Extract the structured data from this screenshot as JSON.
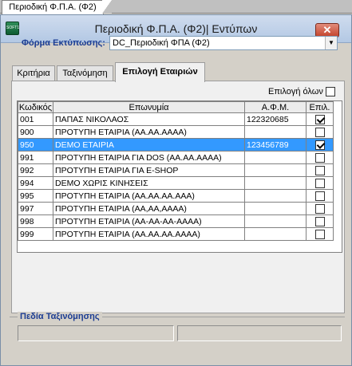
{
  "outer_tab": {
    "label": "Περιοδική Φ.Π.Α. (Φ2)"
  },
  "window": {
    "title": "Περιοδική Φ.Π.Α. (Φ2)| Εντύπων",
    "close_label": "✕",
    "icon_text": "SOFT1"
  },
  "form": {
    "label": "Φόρμα Εκτύπωσης",
    "selected_value": "DC_Περιοδική ΦΠΑ (Φ2)"
  },
  "tabs": [
    {
      "label": "Κριτήρια"
    },
    {
      "label": "Ταξινόμηση"
    },
    {
      "label": "Επιλογή Εταιριών"
    }
  ],
  "active_tab": 2,
  "select_all": {
    "label": "Επιλογή όλων",
    "checked": false
  },
  "grid": {
    "columns": [
      "Κωδικός",
      "Επωνυμία",
      "Α.Φ.Μ.",
      "Επιλ."
    ],
    "rows": [
      {
        "code": "001",
        "name": "ΠΑΠΑΣ ΝΙΚΟΛΑΟΣ",
        "afm": "122320685",
        "checked": true,
        "selected": false
      },
      {
        "code": "900",
        "name": "ΠΡΟΤΥΠΗ  ΕΤΑΙΡΙΑ (ΑΑ.ΑΑ.ΑΑΑΑ)",
        "afm": "",
        "checked": false,
        "selected": false
      },
      {
        "code": "950",
        "name": "DEMO ΕΤΑΙΡΙΑ",
        "afm": "123456789",
        "checked": true,
        "selected": true
      },
      {
        "code": "991",
        "name": "ΠΡΟΤΥΠΗ ΕΤΑΙΡΙΑ ΓΙΑ DOS (ΑΑ.ΑΑ.ΑΑΑΑ)",
        "afm": "",
        "checked": false,
        "selected": false
      },
      {
        "code": "992",
        "name": "ΠΡΟΤΥΠΗ ΕΤΑΙΡΙΑ ΓΙΑ E-SHOP",
        "afm": "",
        "checked": false,
        "selected": false
      },
      {
        "code": "994",
        "name": "DEMO ΧΩΡΙΣ ΚΙΝΗΣΕΙΣ",
        "afm": "",
        "checked": false,
        "selected": false
      },
      {
        "code": "995",
        "name": "ΠΡΟΤΥΠΗ ΕΤΑΙΡΙΑ (ΑΑ.ΑΑ.ΑΑ.ΑΑΑ)",
        "afm": "",
        "checked": false,
        "selected": false
      },
      {
        "code": "997",
        "name": "ΠΡΟΤΥΠΗ ΕΤΑΙΡΙΑ (ΑΑ,ΑΑ,ΑΑΑΑ)",
        "afm": "",
        "checked": false,
        "selected": false
      },
      {
        "code": "998",
        "name": "ΠΡΟΤΥΠΗ ΕΤΑΙΡΙΑ (ΑΑ-ΑΑ-ΑΑ-ΑΑΑΑ)",
        "afm": "",
        "checked": false,
        "selected": false
      },
      {
        "code": "999",
        "name": "ΠΡΟΤΥΠΗ ΕΤΑΙΡΙΑ (ΑΑ.ΑΑ.ΑΑ.ΑΑΑΑ)",
        "afm": "",
        "checked": false,
        "selected": false
      }
    ]
  },
  "sort_group": {
    "title": "Πεδία Ταξινόμησης"
  },
  "colors": {
    "selection": "#3399ff",
    "label_blue": "#1c3d93",
    "close_red": "#c3432b"
  }
}
